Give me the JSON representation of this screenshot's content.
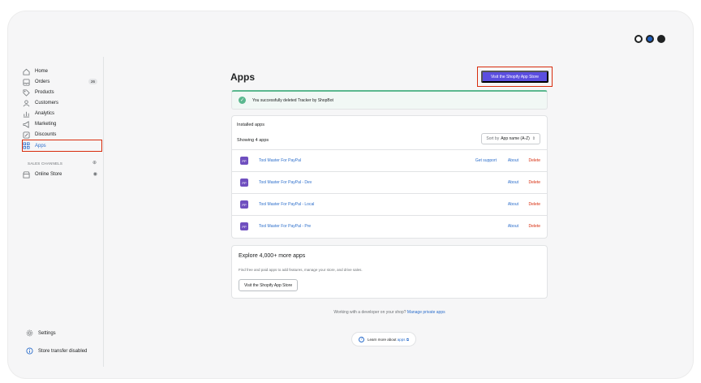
{
  "sidebar": {
    "items": [
      {
        "label": "Home",
        "icon": "home-icon"
      },
      {
        "label": "Orders",
        "icon": "orders-icon",
        "badge": "26"
      },
      {
        "label": "Products",
        "icon": "tag-icon"
      },
      {
        "label": "Customers",
        "icon": "person-icon"
      },
      {
        "label": "Analytics",
        "icon": "bar-chart-icon"
      },
      {
        "label": "Marketing",
        "icon": "megaphone-icon"
      },
      {
        "label": "Discounts",
        "icon": "discount-icon"
      },
      {
        "label": "Apps",
        "icon": "apps-icon",
        "active": true
      }
    ],
    "sales_channels_label": "SALES CHANNELS",
    "online_store_label": "Online Store",
    "settings_label": "Settings",
    "transfer_label": "Store transfer disabled"
  },
  "main": {
    "title": "Apps",
    "visit_store_button": "Visit the Shopify App Store",
    "banner_text": "You successfully deleted Tracker by ShopBot",
    "installed": {
      "title": "Installed apps",
      "showing": "Showing 4 apps",
      "sort_label": "Sort by",
      "sort_value": "App name (A-Z)",
      "apps": [
        {
          "name": "Tool Master For PayPal",
          "support": "Get support",
          "about": "About",
          "delete": "Delete"
        },
        {
          "name": "Tool Master For PayPal - Dev",
          "about": "About",
          "delete": "Delete"
        },
        {
          "name": "Tool Master For PayPal - Local",
          "about": "About",
          "delete": "Delete"
        },
        {
          "name": "Tool Master For PayPal - Pre",
          "about": "About",
          "delete": "Delete"
        }
      ]
    },
    "explore": {
      "title": "Explore 4,000+ more apps",
      "description": "Find free and paid apps to add features, manage your store, and drive sales.",
      "button": "Visit the Shopify App Store"
    },
    "developer_text": "Working with a developer on your shop?",
    "developer_link": "Manage private apps",
    "learn_text": "Learn more about",
    "learn_link": "apps"
  },
  "colors": {
    "accent": "#5b4ee0",
    "link": "#2c6ecb",
    "danger": "#d72c0d",
    "success": "#5bb88f"
  }
}
